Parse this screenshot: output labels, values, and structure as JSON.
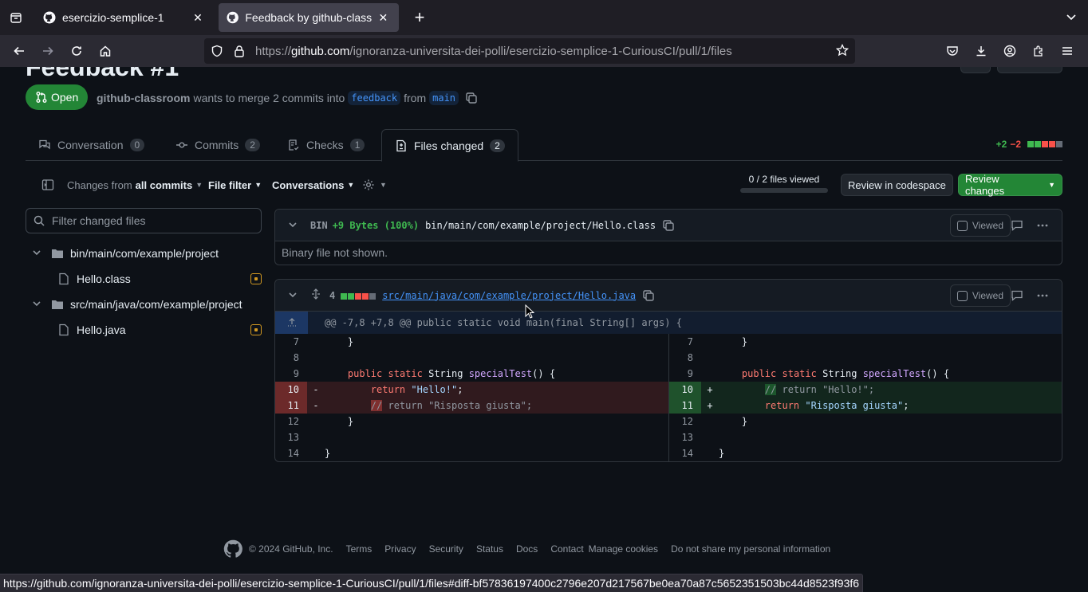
{
  "browser": {
    "tabs": [
      {
        "title": "esercizio-semplice-1",
        "active": false
      },
      {
        "title": "Feedback by github-class",
        "active": true
      }
    ],
    "url_prefix": "https://",
    "url_domain": "github.com",
    "url_path": "/ignoranza-universita-dei-polli/esercizio-semplice-1-CuriousCI/pull/1/files"
  },
  "pr": {
    "title_fragment": "Feedback #1",
    "state": "Open",
    "author": "github-classroom",
    "merge_text": "wants to merge 2 commits into",
    "base_branch": "feedback",
    "from_text": "from",
    "head_branch": "main"
  },
  "tabs": {
    "conversation": {
      "label": "Conversation",
      "count": "0"
    },
    "commits": {
      "label": "Commits",
      "count": "2"
    },
    "checks": {
      "label": "Checks",
      "count": "1"
    },
    "files": {
      "label": "Files changed",
      "count": "2"
    },
    "additions": "+2",
    "deletions": "−2"
  },
  "toolbar": {
    "changes_from": "Changes from",
    "all_commits": "all commits",
    "file_filter": "File filter",
    "conversations": "Conversations",
    "files_viewed": "0 / 2 files viewed",
    "review_codespace": "Review in codespace",
    "review_changes": "Review changes"
  },
  "sidebar": {
    "filter_placeholder": "Filter changed files",
    "tree": [
      {
        "type": "dir",
        "label": "bin/main/com/example/project"
      },
      {
        "type": "file",
        "label": "Hello.class"
      },
      {
        "type": "dir",
        "label": "src/main/java/com/example/project"
      },
      {
        "type": "file",
        "label": "Hello.java"
      }
    ]
  },
  "files": [
    {
      "bin_label": "BIN",
      "size_change": "+9 Bytes (100%)",
      "path": "bin/main/com/example/project/Hello.class",
      "viewed_label": "Viewed",
      "body": "Binary file not shown."
    },
    {
      "changes_count": "4",
      "path": "src/main/java/com/example/project/Hello.java",
      "viewed_label": "Viewed",
      "hunk_header": "@@ -7,8 +7,8 @@ public static void main(final String[] args) {"
    }
  ],
  "diff": {
    "left_numbers": [
      "7",
      "8",
      "9",
      "10",
      "11",
      "12",
      "13",
      "14"
    ],
    "right_numbers": [
      "7",
      "8",
      "9",
      "10",
      "11",
      "12",
      "13",
      "14"
    ],
    "tokens": {
      "brace_close": "}",
      "public": "public",
      "static": "static",
      "String": "String",
      "specialTest": "specialTest",
      "parens": "() {",
      "return": "return",
      "hello_str": "\"Hello!\"",
      "risposta_str": "\"Risposta giusta\"",
      "semicolon": ";",
      "comment": "//",
      "minus": "-",
      "plus": "+"
    }
  },
  "footer": {
    "copyright": "© 2024 GitHub, Inc.",
    "links": [
      "Terms",
      "Privacy",
      "Security",
      "Status",
      "Docs",
      "Contact",
      "Manage cookies",
      "Do not share my personal information"
    ]
  },
  "status_url": "https://github.com/ignoranza-universita-dei-polli/esercizio-semplice-1-CuriousCI/pull/1/files#diff-bf57836197400c2796e207d217567be0ea70a87c5652351503bc44d8523f93f6"
}
